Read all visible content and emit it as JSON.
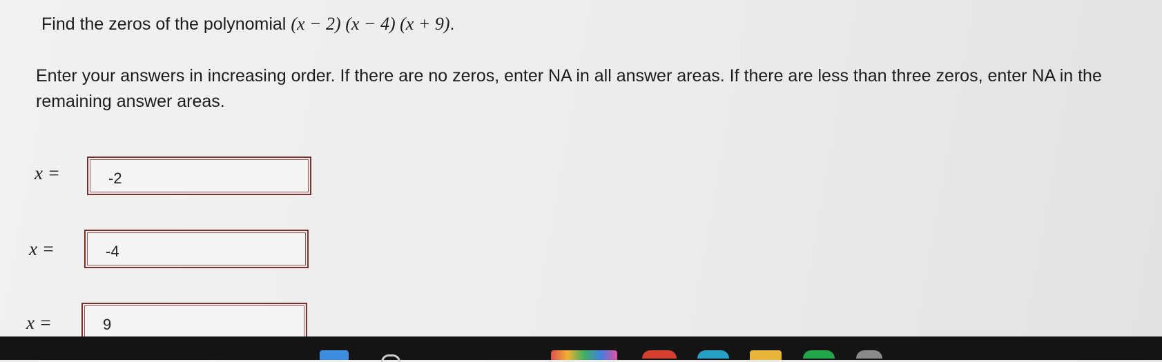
{
  "question": {
    "prefix": "Find the zeros of the polynomial ",
    "expression": "(x − 2) (x − 4) (x + 9)",
    "suffix": "."
  },
  "instructions": "Enter your answers in increasing order. If there are no zeros, enter NA in all answer areas. If there are less than three zeros, enter NA in the remaining answer areas.",
  "answers": [
    {
      "label": "x =",
      "value": "-2"
    },
    {
      "label": "x =",
      "value": "-4"
    },
    {
      "label": "x =",
      "value": "9"
    }
  ],
  "taskbar": {
    "icons": [
      "windows-icon",
      "search-icon",
      "app-icon",
      "chrome-icon",
      "edge-icon",
      "file-explorer-icon",
      "app-green-icon",
      "settings-icon"
    ]
  },
  "colors": {
    "answer_border": "#7b3030",
    "taskbar": "#141414"
  }
}
